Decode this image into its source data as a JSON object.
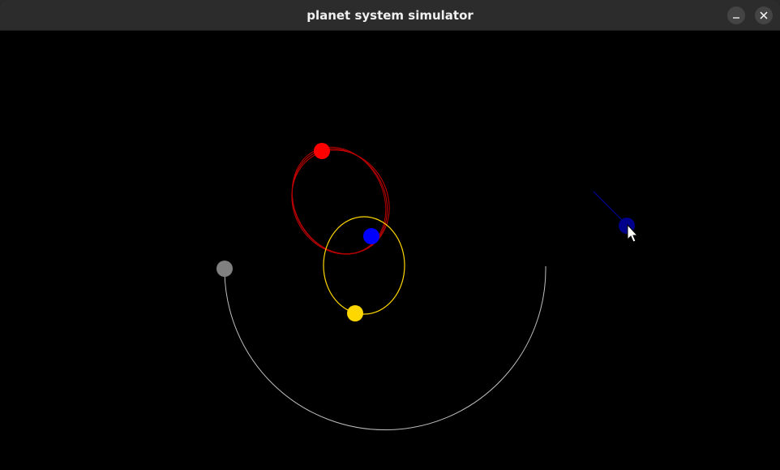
{
  "window": {
    "title": "planet system simulator",
    "minimize_icon": "minimize-icon",
    "close_icon": "close-icon"
  },
  "simulation": {
    "background": "#000000",
    "bodies": [
      {
        "name": "central-star",
        "color": "#0000ff"
      },
      {
        "name": "red-planet",
        "color": "#ff0000",
        "orbit_color": "#cc0000"
      },
      {
        "name": "yellow-planet",
        "color": "#ffd700",
        "orbit_color": "#ffd700"
      },
      {
        "name": "gray-planet",
        "color": "#808080",
        "orbit_color": "#bfbfbf"
      },
      {
        "name": "navy-planet",
        "color": "#00008b",
        "orbit_color": "#00008b"
      }
    ]
  }
}
